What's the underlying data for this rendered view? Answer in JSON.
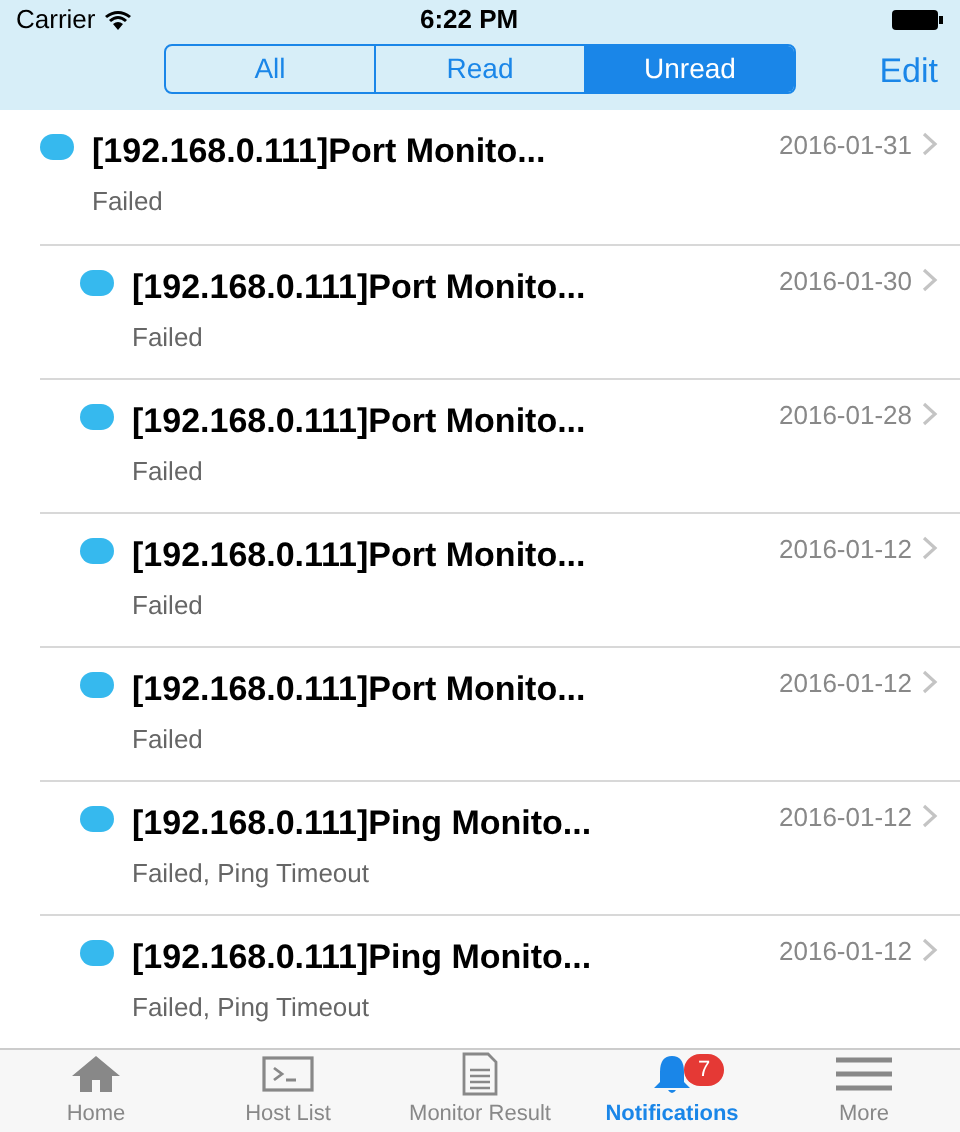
{
  "status_bar": {
    "carrier": "Carrier",
    "time": "6:22 PM"
  },
  "segments": [
    {
      "label": "All",
      "selected": false
    },
    {
      "label": "Read",
      "selected": false
    },
    {
      "label": "Unread",
      "selected": true
    }
  ],
  "edit_button": "Edit",
  "notifications": [
    {
      "title": "[192.168.0.111]Port Monito...",
      "date": "2016-01-31",
      "detail": "Failed",
      "unread": true
    },
    {
      "title": "[192.168.0.111]Port Monito...",
      "date": "2016-01-30",
      "detail": "Failed",
      "unread": true
    },
    {
      "title": "[192.168.0.111]Port Monito...",
      "date": "2016-01-28",
      "detail": "Failed",
      "unread": true
    },
    {
      "title": "[192.168.0.111]Port Monito...",
      "date": "2016-01-12",
      "detail": "Failed",
      "unread": true
    },
    {
      "title": "[192.168.0.111]Port Monito...",
      "date": "2016-01-12",
      "detail": "Failed",
      "unread": true
    },
    {
      "title": "[192.168.0.111]Ping Monito...",
      "date": "2016-01-12",
      "detail": "Failed, Ping Timeout",
      "unread": true
    },
    {
      "title": "[192.168.0.111]Ping Monito...",
      "date": "2016-01-12",
      "detail": "Failed, Ping Timeout",
      "unread": true
    }
  ],
  "tab_bar": [
    {
      "kind": "home",
      "label": "Home",
      "selected": false
    },
    {
      "kind": "terminal",
      "label": "Host List",
      "selected": false
    },
    {
      "kind": "document",
      "label": "Monitor Result",
      "selected": false
    },
    {
      "kind": "bell",
      "label": "Notifications",
      "selected": true,
      "badge": "7"
    },
    {
      "kind": "menu",
      "label": "More",
      "selected": false
    }
  ]
}
